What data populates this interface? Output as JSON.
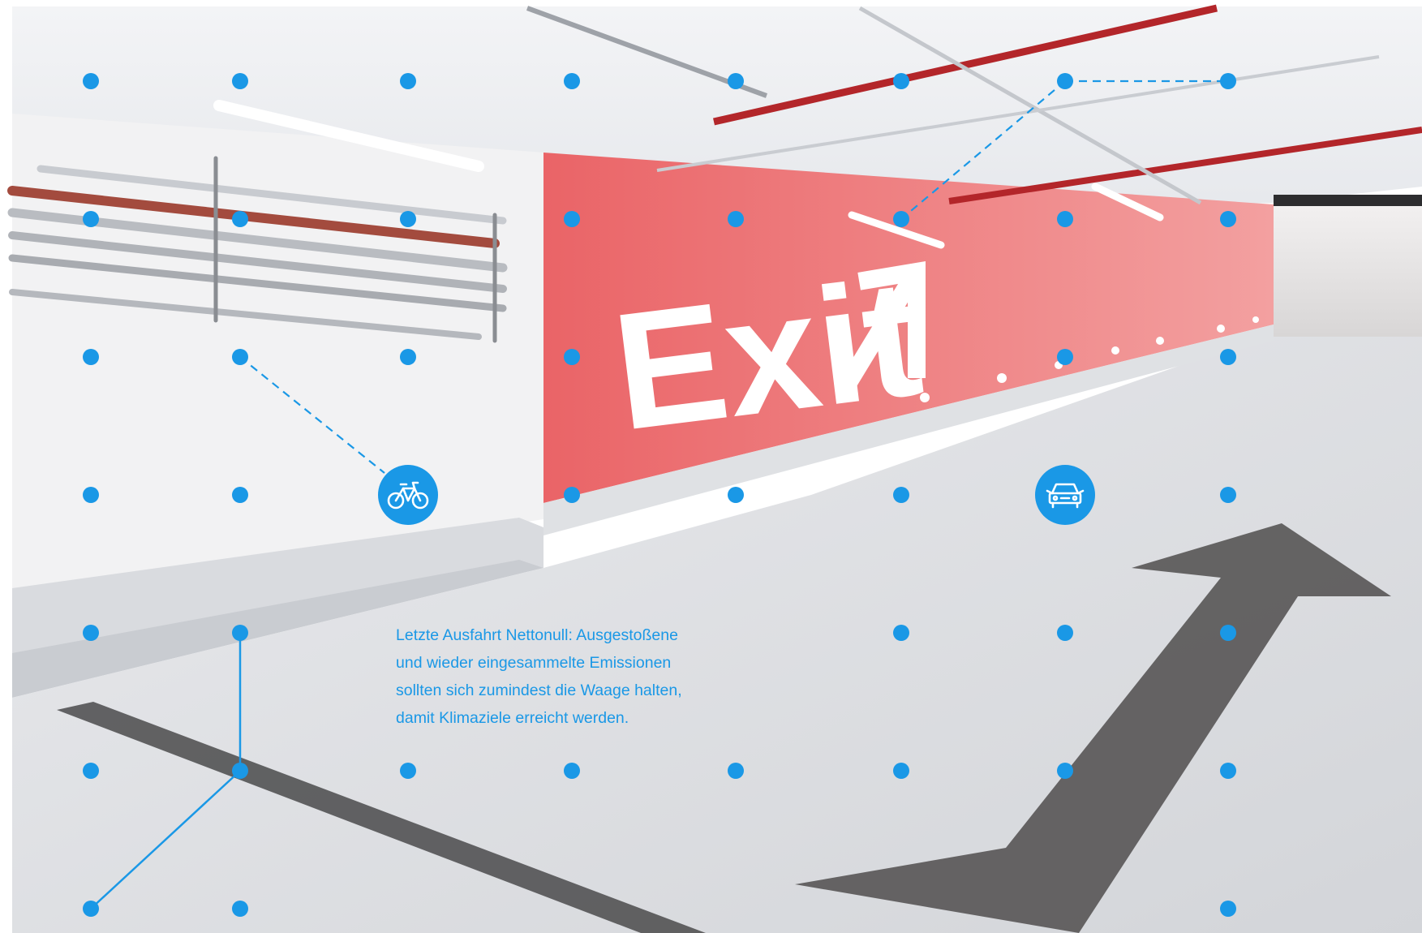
{
  "scene": {
    "wall_sign_text": "Exit",
    "wall_sign_arrow_icon": "arrow-up-right-icon",
    "accent_color": "#1a98e6",
    "wall_color": "#ee6f6f",
    "floor_arrow_color": "#5a5858"
  },
  "caption": {
    "lines": [
      "Letzte Ausfahrt Nettonull: Ausgestoßene",
      "und wieder eingesammelte Emissionen",
      "sollten sich zumindest die Waage halten,",
      "damit Klimaziele erreicht werden."
    ]
  },
  "badges": {
    "bicycle_icon": "bicycle-icon",
    "car_icon": "car-icon"
  }
}
